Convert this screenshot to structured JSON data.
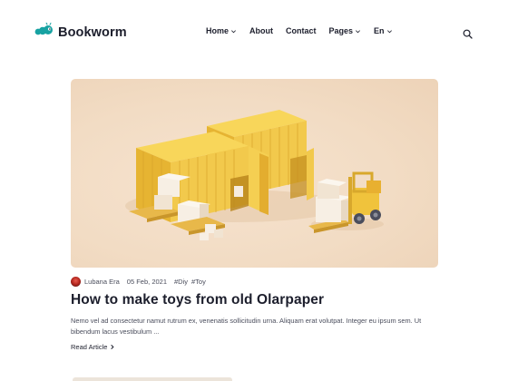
{
  "brand": {
    "name": "Bookworm",
    "accent": "#17a2a2"
  },
  "nav": {
    "items": [
      {
        "label": "Home",
        "has_dropdown": true
      },
      {
        "label": "About",
        "has_dropdown": false
      },
      {
        "label": "Contact",
        "has_dropdown": false
      },
      {
        "label": "Pages",
        "has_dropdown": true
      },
      {
        "label": "En",
        "has_dropdown": true
      }
    ],
    "search_icon": "search-icon"
  },
  "post": {
    "image_colors": {
      "background": "#f2dcc4",
      "container": "#f2c94c",
      "forklift": "#f0c33c"
    },
    "author": "Lubana Era",
    "date": "05 Feb, 2021",
    "tags": [
      "#Diy",
      "#Toy"
    ],
    "title": "How to make toys from old Olarpaper",
    "excerpt_line1": "Nemo vel ad consectetur namut rutrum ex, venenatis sollicitudin urna. Aliquam erat volutpat. Integer eu ipsum sem. Ut",
    "excerpt_line2": "bibendum lacus vestibulum ...",
    "read_more": "Read Article",
    "read_more_icon": "chevron-right-icon"
  }
}
